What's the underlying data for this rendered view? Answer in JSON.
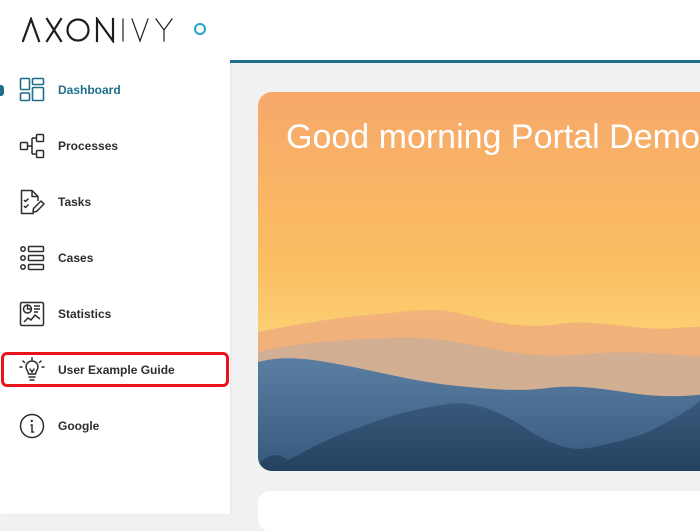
{
  "brand": {
    "logo_text": "AXONIVY"
  },
  "sidebar": {
    "items": [
      {
        "label": "Dashboard",
        "icon": "dashboard-icon",
        "active": true
      },
      {
        "label": "Processes",
        "icon": "processes-icon"
      },
      {
        "label": "Tasks",
        "icon": "tasks-icon"
      },
      {
        "label": "Cases",
        "icon": "cases-icon"
      },
      {
        "label": "Statistics",
        "icon": "statistics-icon"
      },
      {
        "label": "User Example Guide",
        "icon": "lightbulb-icon",
        "highlighted": true
      },
      {
        "label": "Google",
        "icon": "info-icon"
      }
    ]
  },
  "main": {
    "greeting": "Good morning Portal Demo"
  },
  "colors": {
    "accent": "#1f6f8b",
    "brand_ring": "#22a7c8",
    "highlight": "#e8141b",
    "background": "#f0f1f3"
  }
}
